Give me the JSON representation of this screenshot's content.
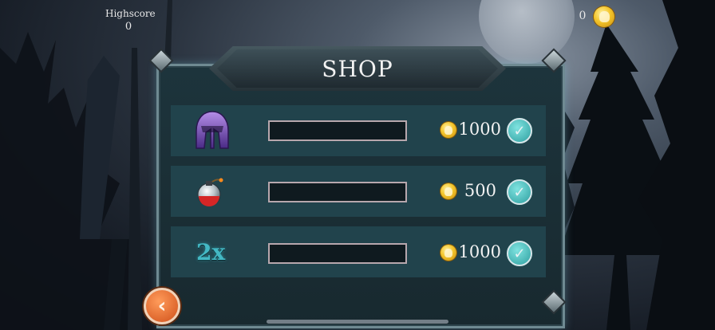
{
  "hud": {
    "highscore_label": "Highscore",
    "highscore_value": "0",
    "coins_value": "0"
  },
  "shop": {
    "title": "SHOP",
    "items": [
      {
        "icon": "spartan-helmet-icon",
        "price": "1000"
      },
      {
        "icon": "potion-bomb-icon",
        "price": "500"
      },
      {
        "icon": "double-multiplier-icon",
        "icon_text": "2x",
        "price": "1000"
      }
    ]
  },
  "buttons": {
    "confirm_glyph": "✓",
    "back_glyph": "‹"
  },
  "colors": {
    "panel": "#1d343c",
    "row": "#21434c",
    "coin": "#f4c52b",
    "confirm": "#2f9fa0",
    "back": "#d0501a"
  }
}
